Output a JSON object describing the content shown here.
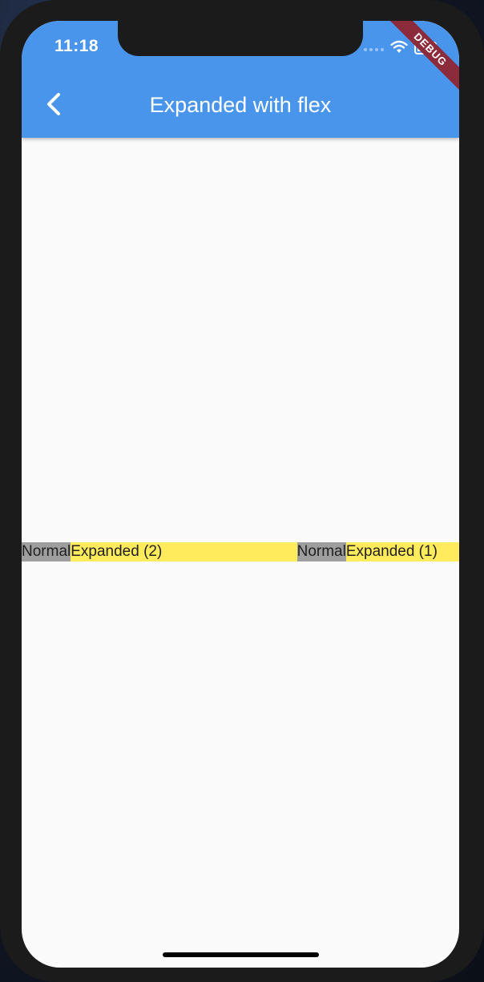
{
  "status_bar": {
    "time": "11:18"
  },
  "debug_banner": "DEBUG",
  "app_bar": {
    "title": "Expanded with flex",
    "back_icon": "chevron-left-icon",
    "color": "#4a95ec"
  },
  "flex_row": {
    "items": [
      {
        "label": "Normal",
        "kind": "normal",
        "color": "#9e9e9e"
      },
      {
        "label": "Expanded (2)",
        "kind": "expanded",
        "flex": 2,
        "color": "#ffeb5b"
      },
      {
        "label": "Normal",
        "kind": "normal",
        "color": "#9e9e9e"
      },
      {
        "label": "Expanded (1)",
        "kind": "expanded",
        "flex": 1,
        "color": "#ffeb5b"
      }
    ]
  }
}
